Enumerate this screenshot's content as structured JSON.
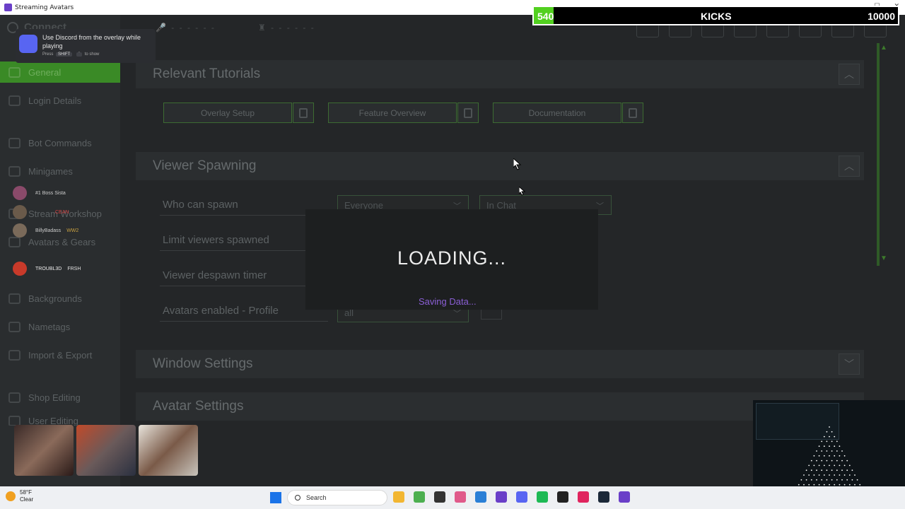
{
  "window": {
    "title": "Streaming Avatars",
    "controls": [
      "—",
      "☐",
      "✕"
    ]
  },
  "kicks": {
    "current": "540",
    "label": "KICKS",
    "max": "10000",
    "progress": 0.054
  },
  "discord_toast": {
    "message": "Use Discord from the overlay while playing",
    "press": "Press",
    "key1": "SHIFT",
    "key2": "`",
    "to_show": "to show"
  },
  "sidebar": {
    "connect": "Connect",
    "items": [
      {
        "label": "General",
        "icon": "home-icon",
        "active": true
      },
      {
        "label": "Login Details",
        "icon": "id-card-icon"
      },
      {
        "label": "Bot Commands",
        "icon": "terminal-icon"
      },
      {
        "label": "Minigames",
        "icon": "gamepad-icon"
      },
      {
        "label": "Stream Workshop",
        "icon": "workshop-icon"
      },
      {
        "label": "Avatars & Gears",
        "icon": "avatar-icon"
      },
      {
        "label": "Backgrounds",
        "icon": "image-icon"
      },
      {
        "label": "Nametags",
        "icon": "text-icon"
      },
      {
        "label": "Import & Export",
        "icon": "transfer-icon"
      },
      {
        "label": "Shop Editing",
        "icon": "cart-icon"
      },
      {
        "label": "User Editing",
        "icon": "user-icon"
      }
    ]
  },
  "voice_users": [
    {
      "name": "#1 Boss Sista",
      "tag": ""
    },
    {
      "name": "",
      "tag": "CEAN"
    },
    {
      "name": "BillyBadass",
      "tag": "WW2"
    },
    {
      "name": "TROUBL3D",
      "tag": "FRSH"
    }
  ],
  "topbar": {
    "mic_status": "- - - - - -",
    "bot_status": "- - - - - -"
  },
  "sections": {
    "tutorials": {
      "title": "Relevant Tutorials",
      "buttons": [
        "Overlay Setup",
        "Feature Overview",
        "Documentation"
      ]
    },
    "viewer_spawning": {
      "title": "Viewer Spawning",
      "rows": [
        {
          "label": "Who can spawn"
        },
        {
          "label": "Limit viewers spawned"
        },
        {
          "label": "Viewer despawn timer"
        },
        {
          "label": "Avatars enabled - Profile"
        }
      ],
      "who_can_spawn": "Everyone",
      "spawn_location": "In Chat",
      "profile_value": "all"
    },
    "window_settings": {
      "title": "Window Settings"
    },
    "avatar_settings": {
      "title": "Avatar Settings"
    }
  },
  "loading": {
    "title": "LOADING...",
    "subtitle": "Saving Data..."
  },
  "taskbar": {
    "weather_temp": "58°F",
    "weather_desc": "Clear",
    "search_placeholder": "Search"
  },
  "colors": {
    "accent": "#3a8a26",
    "loading_sub": "#8b5fd6",
    "kicks_fill": "#52d020"
  }
}
